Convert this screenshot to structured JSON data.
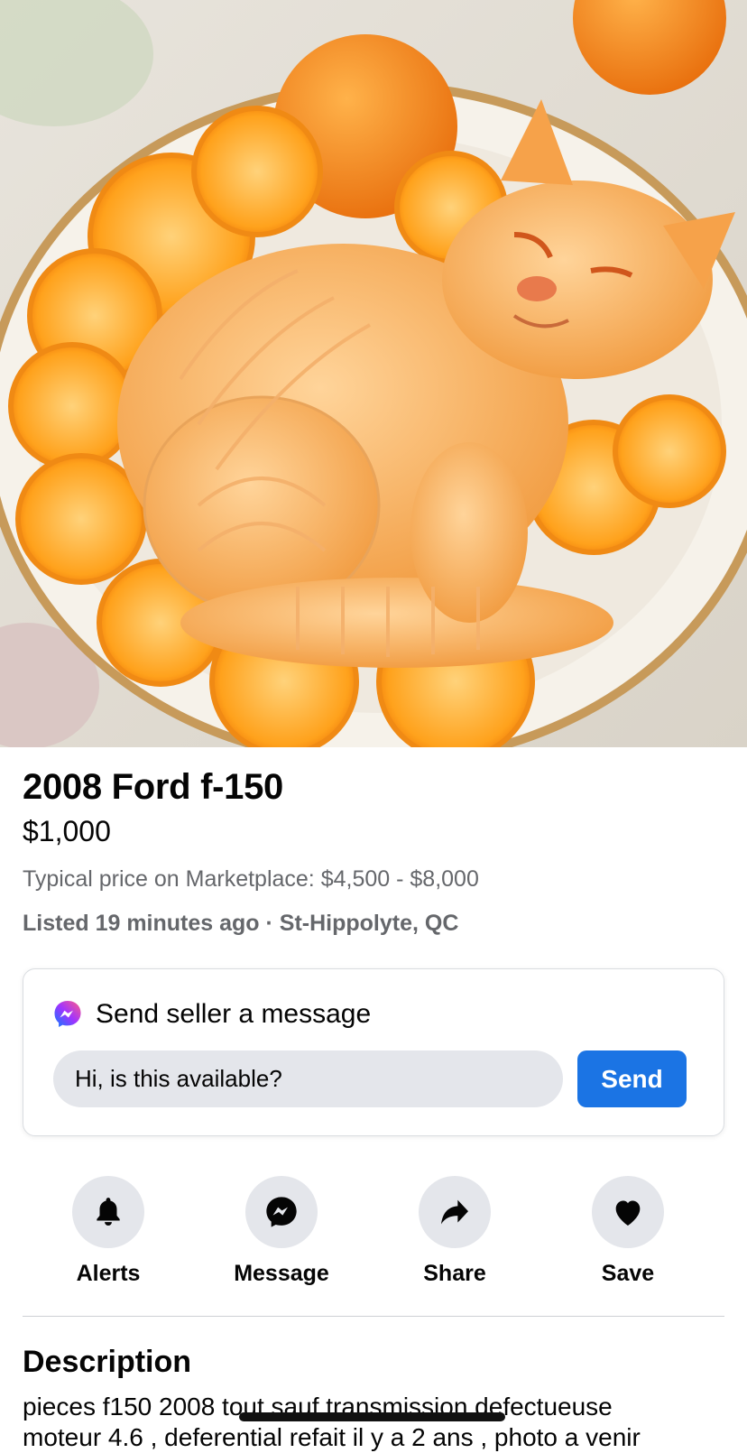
{
  "listing": {
    "title": "2008 Ford f-150",
    "price": "$1,000",
    "typical_price": "Typical price on Marketplace: $4,500 - $8,000",
    "listed": "Listed 19 minutes ago · St-Hippolyte, QC"
  },
  "message_card": {
    "icon": "messenger-icon",
    "heading": "Send seller a message",
    "input_value": "Hi, is this available?",
    "send_label": "Send"
  },
  "actions": [
    {
      "label": "Alerts",
      "icon": "bell-icon"
    },
    {
      "label": "Message",
      "icon": "messenger-icon"
    },
    {
      "label": "Share",
      "icon": "share-arrow-icon"
    },
    {
      "label": "Save",
      "icon": "heart-icon"
    }
  ],
  "description": {
    "heading": "Description",
    "line1": "pieces f150 2008 tout sauf transmission defectueuse",
    "line2": "moteur 4.6 , deferential refait il y a 2 ans , photo a venir"
  },
  "colors": {
    "accent": "#1b74e4",
    "secondary_text": "#65676b",
    "button_bg": "#e4e6eb"
  }
}
